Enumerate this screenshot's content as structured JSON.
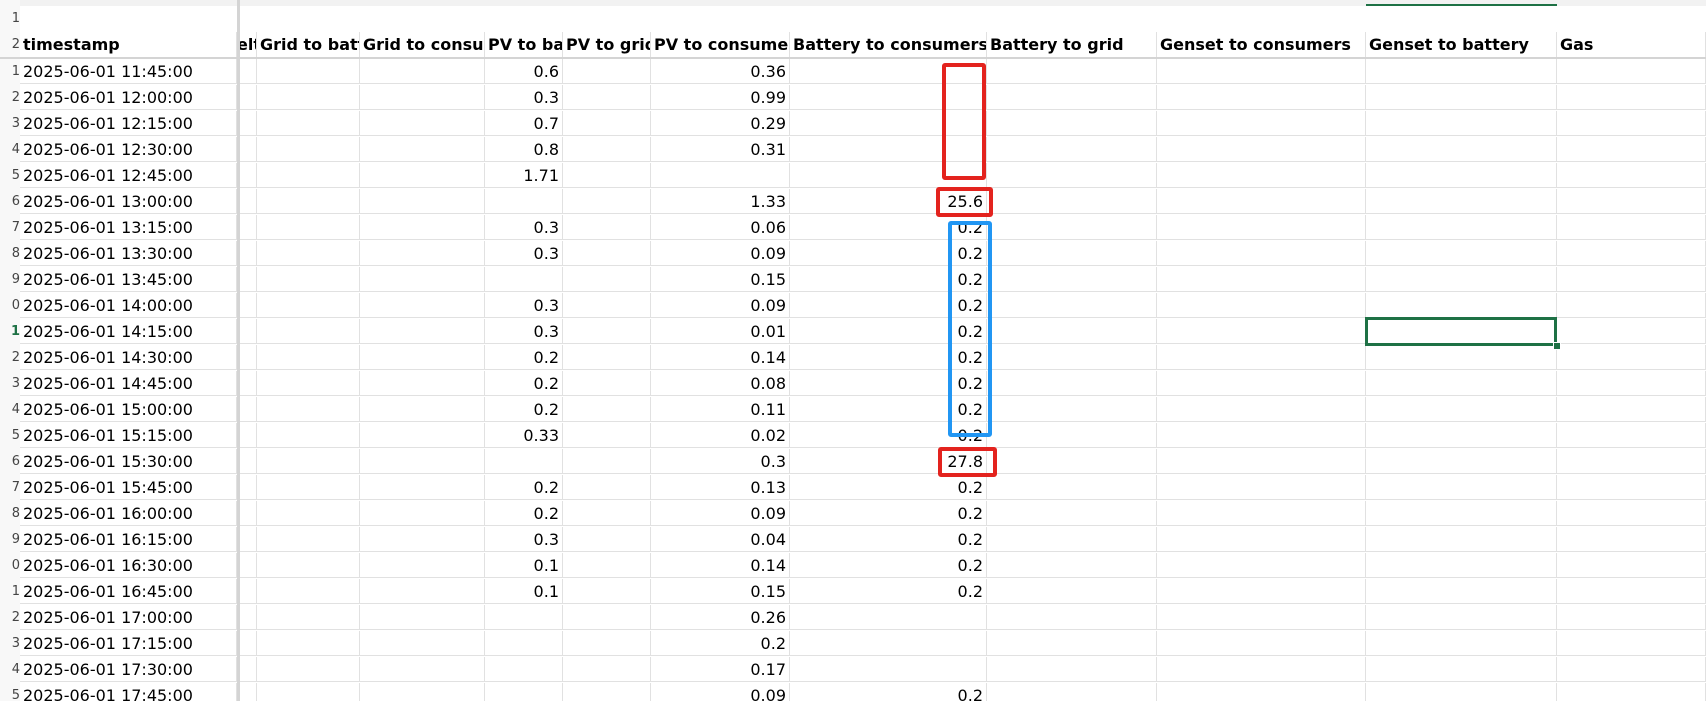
{
  "top_row_number": "1",
  "selected_row_number": "1",
  "columns": [
    {
      "key": "elt",
      "header": "elt"
    },
    {
      "key": "grid_batt",
      "header": "Grid to batt"
    },
    {
      "key": "grid_cons",
      "header": "Grid to consur"
    },
    {
      "key": "pv_batt",
      "header": "PV to ba"
    },
    {
      "key": "pv_grid",
      "header": "PV to grid"
    },
    {
      "key": "pv_cons",
      "header": "PV to consumer"
    },
    {
      "key": "batt_cons",
      "header": "Battery to consumers"
    },
    {
      "key": "batt_grid",
      "header": "Battery to grid"
    },
    {
      "key": "gen_cons",
      "header": "Genset to consumers"
    },
    {
      "key": "gen_batt",
      "header": "Genset to battery"
    },
    {
      "key": "gas",
      "header": "Gas"
    }
  ],
  "timestamp_header": "timestamp",
  "header_row_number": "2",
  "rows": [
    {
      "n": "1",
      "timestamp": "2025-06-01 11:45:00",
      "pv_batt": "0.6",
      "pv_cons": "0.36",
      "batt_cons": ""
    },
    {
      "n": "2",
      "timestamp": "2025-06-01 12:00:00",
      "pv_batt": "0.3",
      "pv_cons": "0.99",
      "batt_cons": ""
    },
    {
      "n": "3",
      "timestamp": "2025-06-01 12:15:00",
      "pv_batt": "0.7",
      "pv_cons": "0.29",
      "batt_cons": ""
    },
    {
      "n": "4",
      "timestamp": "2025-06-01 12:30:00",
      "pv_batt": "0.8",
      "pv_cons": "0.31",
      "batt_cons": ""
    },
    {
      "n": "5",
      "timestamp": "2025-06-01 12:45:00",
      "pv_batt": "1.71",
      "pv_cons": "",
      "batt_cons": ""
    },
    {
      "n": "6",
      "timestamp": "2025-06-01 13:00:00",
      "pv_batt": "",
      "pv_cons": "1.33",
      "batt_cons": "25.6"
    },
    {
      "n": "7",
      "timestamp": "2025-06-01 13:15:00",
      "pv_batt": "0.3",
      "pv_cons": "0.06",
      "batt_cons": "0.2"
    },
    {
      "n": "8",
      "timestamp": "2025-06-01 13:30:00",
      "pv_batt": "0.3",
      "pv_cons": "0.09",
      "batt_cons": "0.2"
    },
    {
      "n": "9",
      "timestamp": "2025-06-01 13:45:00",
      "pv_batt": "",
      "pv_cons": "0.15",
      "batt_cons": "0.2"
    },
    {
      "n": "0",
      "timestamp": "2025-06-01 14:00:00",
      "pv_batt": "0.3",
      "pv_cons": "0.09",
      "batt_cons": "0.2"
    },
    {
      "n": "1",
      "timestamp": "2025-06-01 14:15:00",
      "pv_batt": "0.3",
      "pv_cons": "0.01",
      "batt_cons": "0.2"
    },
    {
      "n": "2",
      "timestamp": "2025-06-01 14:30:00",
      "pv_batt": "0.2",
      "pv_cons": "0.14",
      "batt_cons": "0.2"
    },
    {
      "n": "3",
      "timestamp": "2025-06-01 14:45:00",
      "pv_batt": "0.2",
      "pv_cons": "0.08",
      "batt_cons": "0.2"
    },
    {
      "n": "4",
      "timestamp": "2025-06-01 15:00:00",
      "pv_batt": "0.2",
      "pv_cons": "0.11",
      "batt_cons": "0.2"
    },
    {
      "n": "5",
      "timestamp": "2025-06-01 15:15:00",
      "pv_batt": "0.33",
      "pv_cons": "0.02",
      "batt_cons": "0.2"
    },
    {
      "n": "6",
      "timestamp": "2025-06-01 15:30:00",
      "pv_batt": "",
      "pv_cons": "0.3",
      "batt_cons": "27.8"
    },
    {
      "n": "7",
      "timestamp": "2025-06-01 15:45:00",
      "pv_batt": "0.2",
      "pv_cons": "0.13",
      "batt_cons": "0.2"
    },
    {
      "n": "8",
      "timestamp": "2025-06-01 16:00:00",
      "pv_batt": "0.2",
      "pv_cons": "0.09",
      "batt_cons": "0.2"
    },
    {
      "n": "9",
      "timestamp": "2025-06-01 16:15:00",
      "pv_batt": "0.3",
      "pv_cons": "0.04",
      "batt_cons": "0.2"
    },
    {
      "n": "0",
      "timestamp": "2025-06-01 16:30:00",
      "pv_batt": "0.1",
      "pv_cons": "0.14",
      "batt_cons": "0.2"
    },
    {
      "n": "1",
      "timestamp": "2025-06-01 16:45:00",
      "pv_batt": "0.1",
      "pv_cons": "0.15",
      "batt_cons": "0.2"
    },
    {
      "n": "2",
      "timestamp": "2025-06-01 17:00:00",
      "pv_batt": "",
      "pv_cons": "0.26",
      "batt_cons": ""
    },
    {
      "n": "3",
      "timestamp": "2025-06-01 17:15:00",
      "pv_batt": "",
      "pv_cons": "0.2",
      "batt_cons": ""
    },
    {
      "n": "4",
      "timestamp": "2025-06-01 17:30:00",
      "pv_batt": "",
      "pv_cons": "0.17",
      "batt_cons": ""
    },
    {
      "n": "5",
      "timestamp": "2025-06-01 17:45:00",
      "pv_batt": "",
      "pv_cons": "0.09",
      "batt_cons": "0.2"
    }
  ],
  "annotations": {
    "red_color": "#e3231e",
    "blue_color": "#2196f3",
    "selection_color": "#1e7145"
  }
}
